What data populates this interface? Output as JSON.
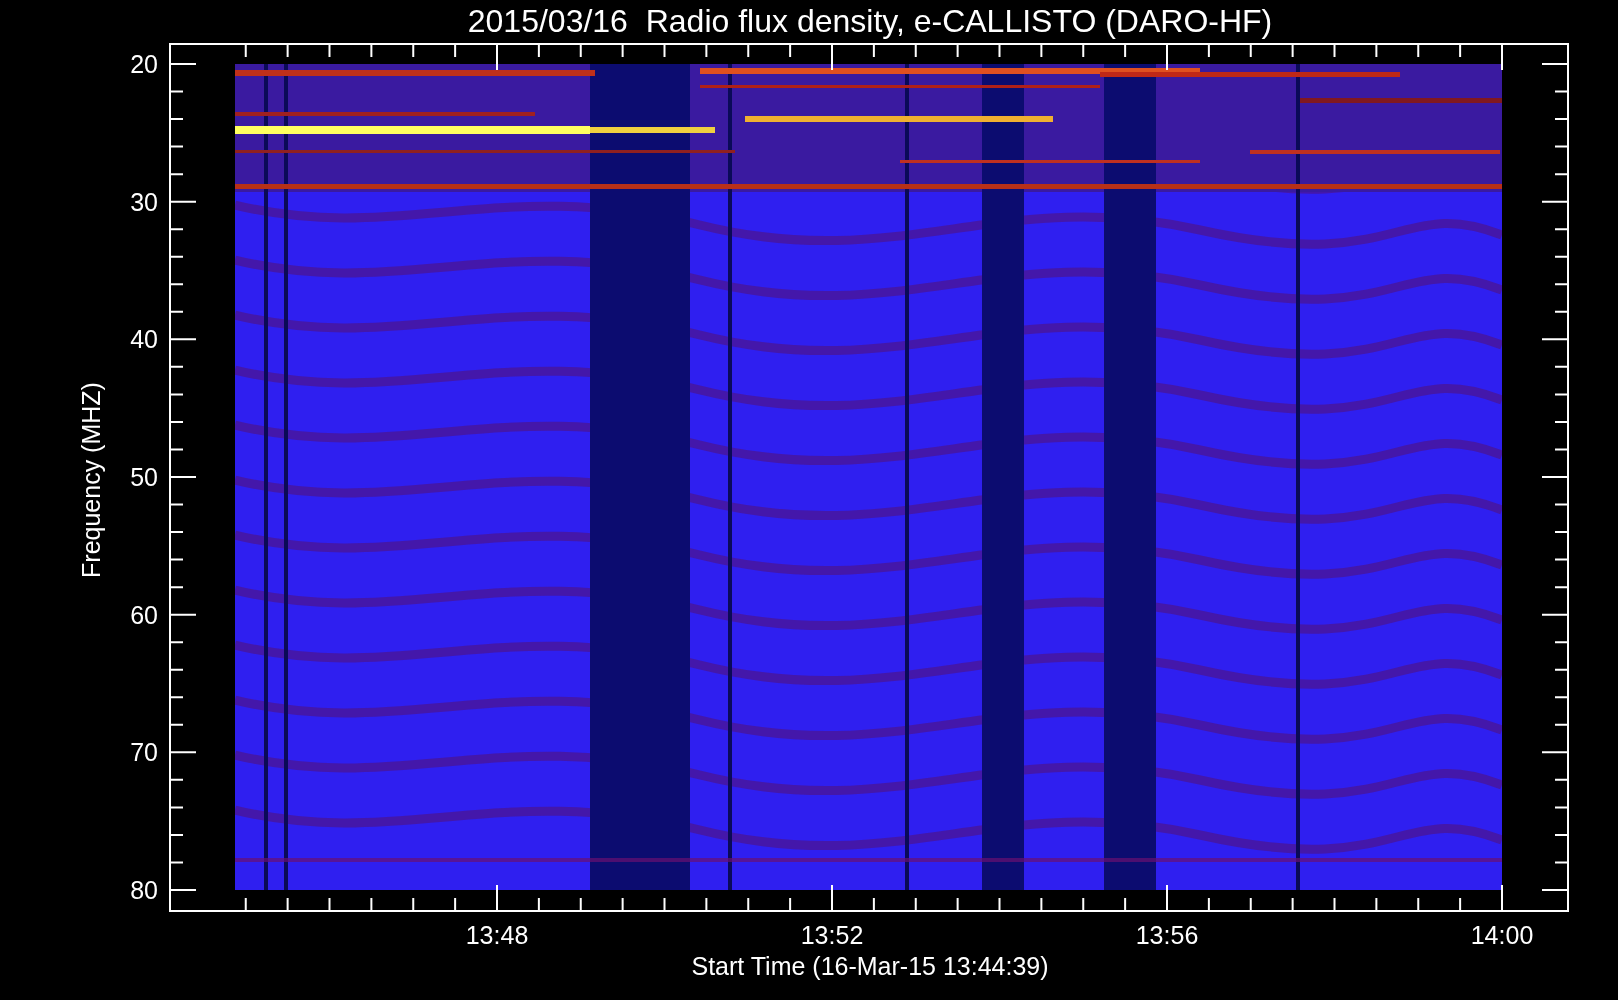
{
  "title": "2015/03/16  Radio flux density, e-CALLISTO (DARO-HF)",
  "y_axis": {
    "label": "Frequency (MHZ)",
    "ticks": [
      "20",
      "30",
      "40",
      "50",
      "60",
      "70",
      "80"
    ]
  },
  "x_axis": {
    "label": "Start Time (16-Mar-15 13:44:39)",
    "ticks": [
      "13:48",
      "13:52",
      "13:56",
      "14:00"
    ]
  }
}
